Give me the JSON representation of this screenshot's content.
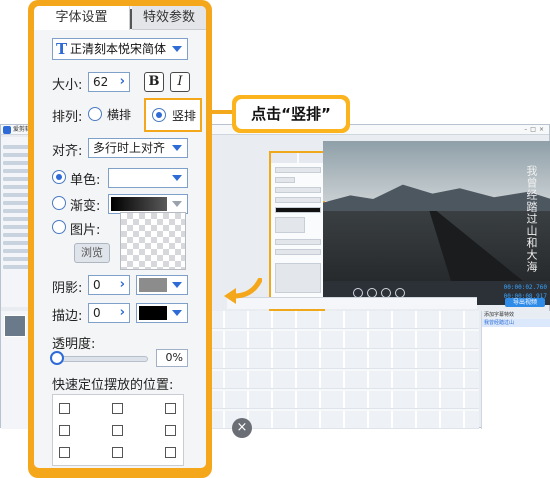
{
  "callout": {
    "text": "点击“竖排”"
  },
  "panel": {
    "tabs": [
      "字体设置",
      "特效参数"
    ],
    "font": {
      "icon": "T",
      "name": "正清刻本悦宋简体"
    },
    "size": {
      "label": "大小:",
      "value": "62",
      "bold": "B",
      "italic": "I"
    },
    "arrange": {
      "label": "排列:",
      "horizontal": "横排",
      "vertical": "竖排",
      "selected": "vertical"
    },
    "align": {
      "label": "对齐:",
      "value": "多行时上对齐"
    },
    "solid": {
      "label": "单色:",
      "color": "#ffffff"
    },
    "gradient": {
      "label": "渐变:",
      "color_start": "#000000",
      "color_end": "#5a5a5a"
    },
    "image": {
      "label": "图片:",
      "browse": "浏览"
    },
    "shadow": {
      "label": "阴影:",
      "value": "0",
      "color": "#8c8c8c"
    },
    "stroke": {
      "label": "描边:",
      "value": "0",
      "color": "#000000"
    },
    "opacity": {
      "label": "透明度:",
      "value": "0%"
    },
    "quick_position": {
      "label": "快速定位摆放的位置:"
    }
  },
  "background": {
    "window_title": "爱剪辑",
    "vertical_caption": "我曾经踏过山和大海",
    "time_current": "00:00:02.760",
    "time_total": "00:00:08.917",
    "export_label": "导出视频",
    "props_header": "添加字幕特效",
    "props_row": "我曾经踏过山"
  },
  "colors": {
    "accent_orange": "#f5a71c",
    "accent_blue": "#2f6bd6"
  }
}
